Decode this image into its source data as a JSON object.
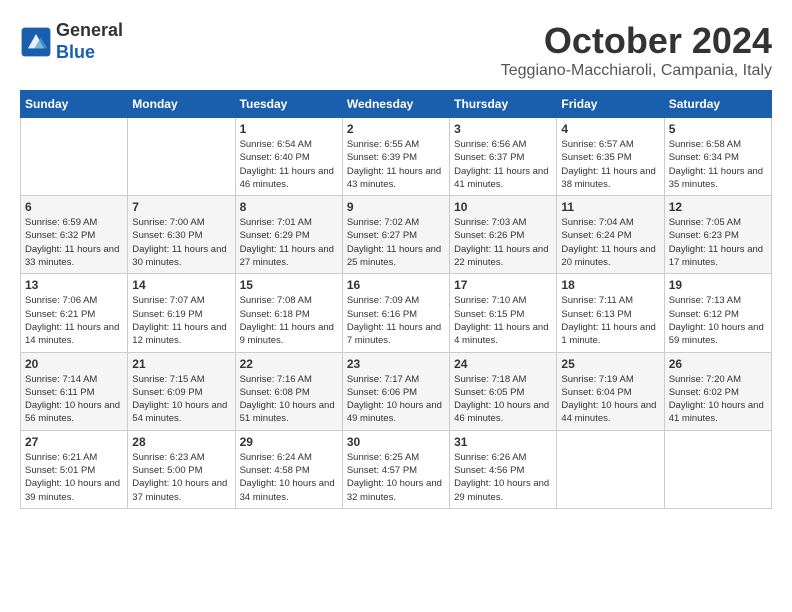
{
  "header": {
    "logo": {
      "line1": "General",
      "line2": "Blue"
    },
    "title": "October 2024",
    "subtitle": "Teggiano-Macchiaroli, Campania, Italy"
  },
  "calendar": {
    "days_of_week": [
      "Sunday",
      "Monday",
      "Tuesday",
      "Wednesday",
      "Thursday",
      "Friday",
      "Saturday"
    ],
    "weeks": [
      [
        {
          "day": "",
          "info": ""
        },
        {
          "day": "",
          "info": ""
        },
        {
          "day": "1",
          "info": "Sunrise: 6:54 AM\nSunset: 6:40 PM\nDaylight: 11 hours and 46 minutes."
        },
        {
          "day": "2",
          "info": "Sunrise: 6:55 AM\nSunset: 6:39 PM\nDaylight: 11 hours and 43 minutes."
        },
        {
          "day": "3",
          "info": "Sunrise: 6:56 AM\nSunset: 6:37 PM\nDaylight: 11 hours and 41 minutes."
        },
        {
          "day": "4",
          "info": "Sunrise: 6:57 AM\nSunset: 6:35 PM\nDaylight: 11 hours and 38 minutes."
        },
        {
          "day": "5",
          "info": "Sunrise: 6:58 AM\nSunset: 6:34 PM\nDaylight: 11 hours and 35 minutes."
        }
      ],
      [
        {
          "day": "6",
          "info": "Sunrise: 6:59 AM\nSunset: 6:32 PM\nDaylight: 11 hours and 33 minutes."
        },
        {
          "day": "7",
          "info": "Sunrise: 7:00 AM\nSunset: 6:30 PM\nDaylight: 11 hours and 30 minutes."
        },
        {
          "day": "8",
          "info": "Sunrise: 7:01 AM\nSunset: 6:29 PM\nDaylight: 11 hours and 27 minutes."
        },
        {
          "day": "9",
          "info": "Sunrise: 7:02 AM\nSunset: 6:27 PM\nDaylight: 11 hours and 25 minutes."
        },
        {
          "day": "10",
          "info": "Sunrise: 7:03 AM\nSunset: 6:26 PM\nDaylight: 11 hours and 22 minutes."
        },
        {
          "day": "11",
          "info": "Sunrise: 7:04 AM\nSunset: 6:24 PM\nDaylight: 11 hours and 20 minutes."
        },
        {
          "day": "12",
          "info": "Sunrise: 7:05 AM\nSunset: 6:23 PM\nDaylight: 11 hours and 17 minutes."
        }
      ],
      [
        {
          "day": "13",
          "info": "Sunrise: 7:06 AM\nSunset: 6:21 PM\nDaylight: 11 hours and 14 minutes."
        },
        {
          "day": "14",
          "info": "Sunrise: 7:07 AM\nSunset: 6:19 PM\nDaylight: 11 hours and 12 minutes."
        },
        {
          "day": "15",
          "info": "Sunrise: 7:08 AM\nSunset: 6:18 PM\nDaylight: 11 hours and 9 minutes."
        },
        {
          "day": "16",
          "info": "Sunrise: 7:09 AM\nSunset: 6:16 PM\nDaylight: 11 hours and 7 minutes."
        },
        {
          "day": "17",
          "info": "Sunrise: 7:10 AM\nSunset: 6:15 PM\nDaylight: 11 hours and 4 minutes."
        },
        {
          "day": "18",
          "info": "Sunrise: 7:11 AM\nSunset: 6:13 PM\nDaylight: 11 hours and 1 minute."
        },
        {
          "day": "19",
          "info": "Sunrise: 7:13 AM\nSunset: 6:12 PM\nDaylight: 10 hours and 59 minutes."
        }
      ],
      [
        {
          "day": "20",
          "info": "Sunrise: 7:14 AM\nSunset: 6:11 PM\nDaylight: 10 hours and 56 minutes."
        },
        {
          "day": "21",
          "info": "Sunrise: 7:15 AM\nSunset: 6:09 PM\nDaylight: 10 hours and 54 minutes."
        },
        {
          "day": "22",
          "info": "Sunrise: 7:16 AM\nSunset: 6:08 PM\nDaylight: 10 hours and 51 minutes."
        },
        {
          "day": "23",
          "info": "Sunrise: 7:17 AM\nSunset: 6:06 PM\nDaylight: 10 hours and 49 minutes."
        },
        {
          "day": "24",
          "info": "Sunrise: 7:18 AM\nSunset: 6:05 PM\nDaylight: 10 hours and 46 minutes."
        },
        {
          "day": "25",
          "info": "Sunrise: 7:19 AM\nSunset: 6:04 PM\nDaylight: 10 hours and 44 minutes."
        },
        {
          "day": "26",
          "info": "Sunrise: 7:20 AM\nSunset: 6:02 PM\nDaylight: 10 hours and 41 minutes."
        }
      ],
      [
        {
          "day": "27",
          "info": "Sunrise: 6:21 AM\nSunset: 5:01 PM\nDaylight: 10 hours and 39 minutes."
        },
        {
          "day": "28",
          "info": "Sunrise: 6:23 AM\nSunset: 5:00 PM\nDaylight: 10 hours and 37 minutes."
        },
        {
          "day": "29",
          "info": "Sunrise: 6:24 AM\nSunset: 4:58 PM\nDaylight: 10 hours and 34 minutes."
        },
        {
          "day": "30",
          "info": "Sunrise: 6:25 AM\nSunset: 4:57 PM\nDaylight: 10 hours and 32 minutes."
        },
        {
          "day": "31",
          "info": "Sunrise: 6:26 AM\nSunset: 4:56 PM\nDaylight: 10 hours and 29 minutes."
        },
        {
          "day": "",
          "info": ""
        },
        {
          "day": "",
          "info": ""
        }
      ]
    ]
  }
}
